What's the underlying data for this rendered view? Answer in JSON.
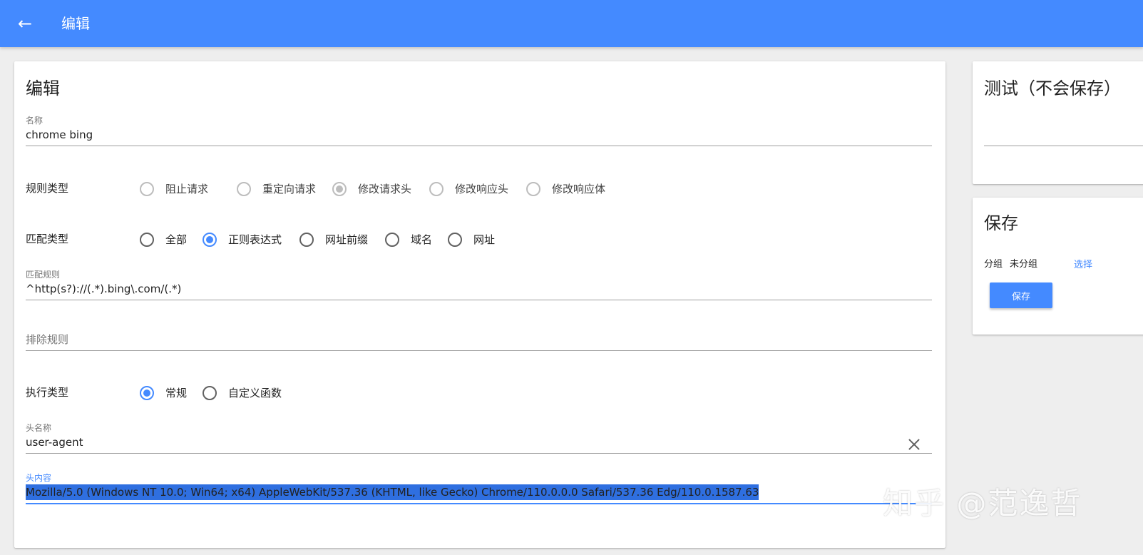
{
  "appbar": {
    "title": "编辑",
    "back_icon": "←"
  },
  "main": {
    "title": "编辑",
    "name_field": {
      "label": "名称",
      "value": "chrome bing"
    },
    "rule_type": {
      "label": "规则类型",
      "options": [
        "阻止请求",
        "重定向请求",
        "修改请求头",
        "修改响应头",
        "修改响应体"
      ],
      "selected": "修改请求头"
    },
    "match_type": {
      "label": "匹配类型",
      "options": [
        "全部",
        "正则表达式",
        "网址前缀",
        "域名",
        "网址"
      ],
      "selected": "正则表达式"
    },
    "match_rule": {
      "label": "匹配规则",
      "value": "^http(s?)://(.*).bing\\.com/(.*)"
    },
    "exclude_rule": {
      "placeholder": "排除规则",
      "value": ""
    },
    "exec_type": {
      "label": "执行类型",
      "options": [
        "常规",
        "自定义函数"
      ],
      "selected": "常规"
    },
    "header_name": {
      "label": "头名称",
      "value": "user-agent"
    },
    "header_content": {
      "label": "头内容",
      "value": "Mozilla/5.0 (Windows NT 10.0; Win64; x64) AppleWebKit/537.36 (KHTML, like Gecko) Chrome/110.0.0.0 Safari/537.36 Edg/110.0.1587.63"
    }
  },
  "test_card": {
    "title": "测试（不会保存）"
  },
  "save_card": {
    "title": "保存",
    "group_label": "分组",
    "group_value": "未分组",
    "choose_link": "选择",
    "save_button": "保存"
  },
  "watermark": "知乎 @范逸哲",
  "colors": {
    "accent": "#448aff",
    "background": "#eeeeee",
    "selection": "#2f6fe0"
  }
}
